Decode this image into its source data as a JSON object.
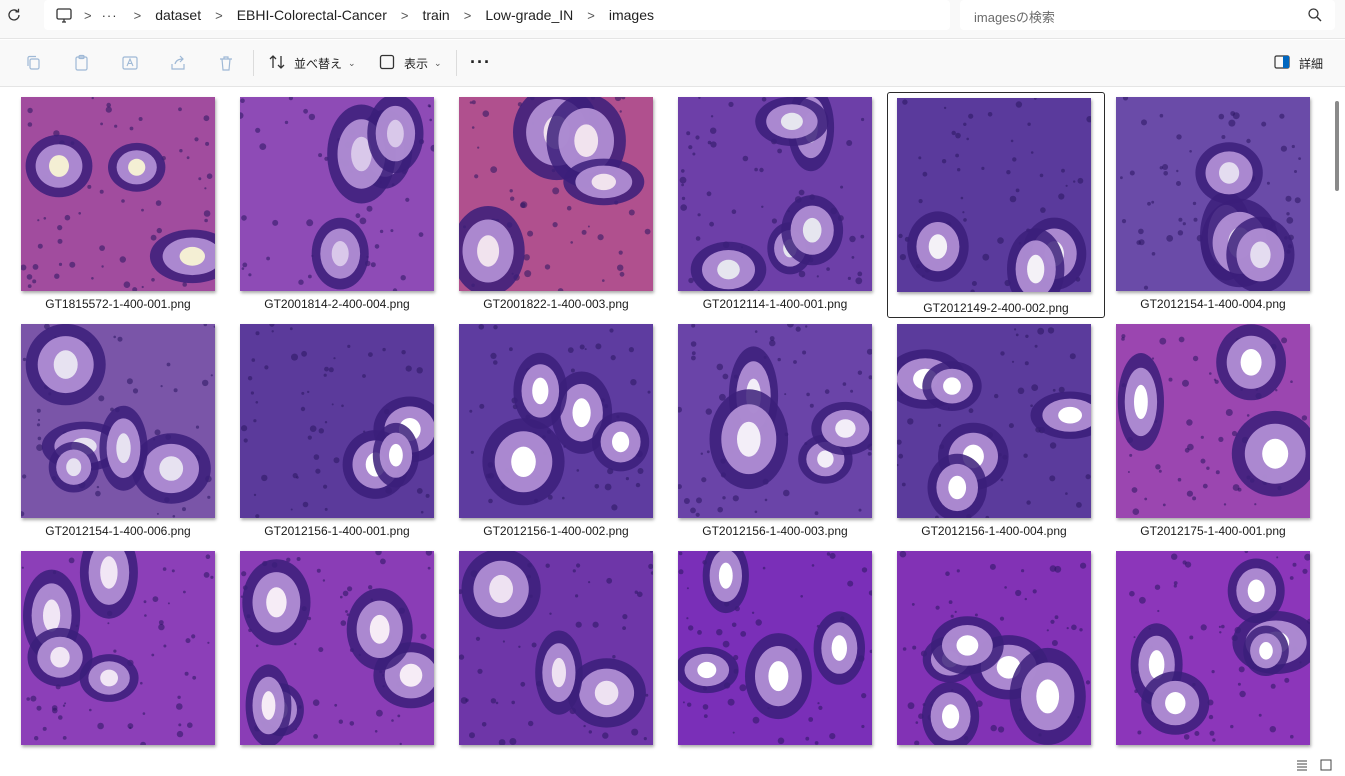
{
  "address_bar": {
    "breadcrumbs": [
      "dataset",
      "EBHI-Colorectal-Cancer",
      "train",
      "Low-grade_IN",
      "images"
    ],
    "overflow": "···",
    "search_placeholder": "imagesの検索"
  },
  "toolbar": {
    "sort_label": "並べ替え",
    "view_label": "表示",
    "more_label": "···",
    "details_label": "詳細"
  },
  "files": [
    {
      "name": "GT1815572-1-400-001.png",
      "tone": "#a14c9e",
      "lumen": "#f4efd4"
    },
    {
      "name": "GT2001814-2-400-004.png",
      "tone": "#8e4bb6",
      "lumen": "#d9c8ea"
    },
    {
      "name": "GT2001822-1-400-003.png",
      "tone": "#b0508e",
      "lumen": "#f1e3ee"
    },
    {
      "name": "GT2012114-1-400-001.png",
      "tone": "#6d3fa8",
      "lumen": "#e6e6ef"
    },
    {
      "name": "GT2012149-2-400-002.png",
      "tone": "#5a3a9c",
      "lumen": "#f4f1f7"
    },
    {
      "name": "GT2012154-1-400-004.png",
      "tone": "#6a4ba8",
      "lumen": "#e4dcf0"
    },
    {
      "name": "GT2012154-1-400-006.png",
      "tone": "#7a55a8",
      "lumen": "#e7e2f1"
    },
    {
      "name": "GT2012156-1-400-001.png",
      "tone": "#5b3a9b",
      "lumen": "#ffffff"
    },
    {
      "name": "GT2012156-1-400-002.png",
      "tone": "#5e3ca0",
      "lumen": "#ffffff"
    },
    {
      "name": "GT2012156-1-400-003.png",
      "tone": "#6a44a8",
      "lumen": "#f3eef8"
    },
    {
      "name": "GT2012156-1-400-004.png",
      "tone": "#5b3b9c",
      "lumen": "#ffffff"
    },
    {
      "name": "GT2012175-1-400-001.png",
      "tone": "#9b46b0",
      "lumen": "#ffffff"
    },
    {
      "name": "",
      "tone": "#8c3fb8",
      "lumen": "#f1e6f5"
    },
    {
      "name": "",
      "tone": "#8a3db6",
      "lumen": "#f6ecf6"
    },
    {
      "name": "",
      "tone": "#6e36a8",
      "lumen": "#eee2f2"
    },
    {
      "name": "",
      "tone": "#7a2fb8",
      "lumen": "#ffffff"
    },
    {
      "name": "",
      "tone": "#8232b5",
      "lumen": "#ffffff"
    },
    {
      "name": "",
      "tone": "#8c36ba",
      "lumen": "#ffffff"
    }
  ],
  "selected_file": "GT2012149-2-400-002.png",
  "colors": {
    "chrome_bg": "#f9f9f9",
    "selection_border": "#2b2b2b"
  }
}
